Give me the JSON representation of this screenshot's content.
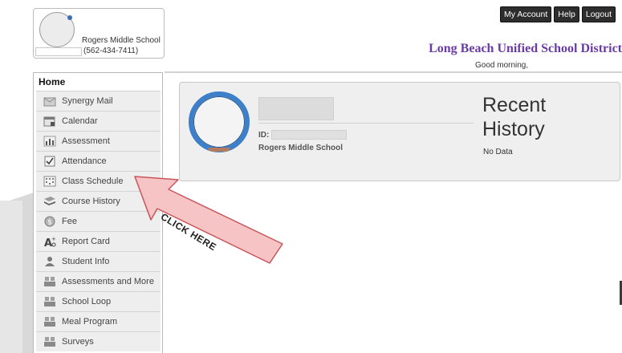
{
  "header": {
    "school_name": "Rogers Middle School",
    "school_phone": "(562-434-7411)",
    "buttons": {
      "account": "My Account",
      "help": "Help",
      "logout": "Logout"
    },
    "district": "Long Beach Unified School District",
    "greeting": "Good morning,"
  },
  "sidebar": {
    "home_label": "Home",
    "items": [
      {
        "label": "Synergy Mail",
        "icon": "mail-icon"
      },
      {
        "label": "Calendar",
        "icon": "calendar-icon"
      },
      {
        "label": "Assessment",
        "icon": "bar-chart-icon"
      },
      {
        "label": "Attendance",
        "icon": "checkbox-icon"
      },
      {
        "label": "Class Schedule",
        "icon": "schedule-grid-icon"
      },
      {
        "label": "Course History",
        "icon": "books-icon"
      },
      {
        "label": "Fee",
        "icon": "dollar-icon"
      },
      {
        "label": "Report Card",
        "icon": "grade-icon"
      },
      {
        "label": "Student Info",
        "icon": "student-icon"
      },
      {
        "label": "Assessments and More",
        "icon": "people-icon"
      },
      {
        "label": "School Loop",
        "icon": "people-icon"
      },
      {
        "label": "Meal Program",
        "icon": "people-icon"
      },
      {
        "label": "Surveys",
        "icon": "people-icon"
      }
    ]
  },
  "student_card": {
    "id_label": "ID:",
    "school": "Rogers Middle School",
    "recent_history_title": "Recent History",
    "recent_history_value": "No Data"
  },
  "annotation": {
    "text": "CLICK HERE"
  },
  "colors": {
    "district_text": "#6a3aa6",
    "avatar_ring": "#3d80c9",
    "arrow_fill": "#f6c4c4",
    "arrow_stroke": "#c8555a"
  }
}
